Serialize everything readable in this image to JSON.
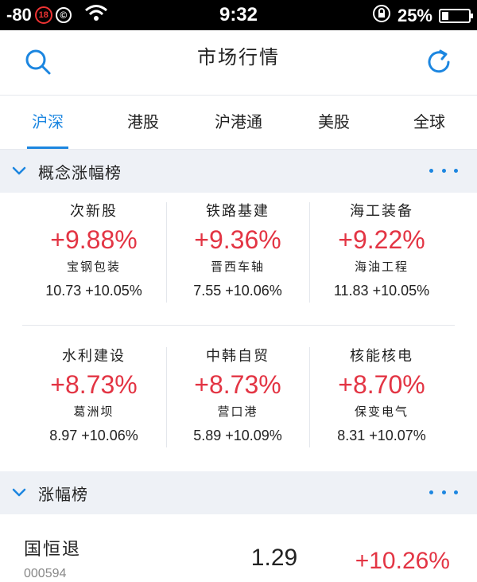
{
  "status_bar": {
    "signal": "-80",
    "badge": "18",
    "copyright": "©",
    "time": "9:32",
    "battery": "25%",
    "battery_level": 0.25
  },
  "header": {
    "title": "市场行情"
  },
  "tabs": [
    {
      "label": "沪深",
      "active": true
    },
    {
      "label": "港股",
      "active": false
    },
    {
      "label": "沪港通",
      "active": false
    },
    {
      "label": "美股",
      "active": false
    },
    {
      "label": "全球",
      "active": false
    }
  ],
  "colors": {
    "accent": "#1c86e0",
    "up": "#e33544",
    "section_bg": "#eef1f6"
  },
  "concept_section": {
    "title": "概念涨幅榜",
    "items": [
      {
        "name": "次新股",
        "change": "+9.88%",
        "stock": "宝钢包装",
        "price": "10.73",
        "stock_change": "+10.05%"
      },
      {
        "name": "铁路基建",
        "change": "+9.36%",
        "stock": "晋西车轴",
        "price": "7.55",
        "stock_change": "+10.06%"
      },
      {
        "name": "海工装备",
        "change": "+9.22%",
        "stock": "海油工程",
        "price": "11.83",
        "stock_change": "+10.05%"
      },
      {
        "name": "水利建设",
        "change": "+8.73%",
        "stock": "葛洲坝",
        "price": "8.97",
        "stock_change": "+10.06%"
      },
      {
        "name": "中韩自贸",
        "change": "+8.73%",
        "stock": "营口港",
        "price": "5.89",
        "stock_change": "+10.09%"
      },
      {
        "name": "核能核电",
        "change": "+8.70%",
        "stock": "保变电气",
        "price": "8.31",
        "stock_change": "+10.07%"
      }
    ]
  },
  "gainers_section": {
    "title": "涨幅榜",
    "rows": [
      {
        "name": "国恒退",
        "code": "000594",
        "price": "1.29",
        "change": "+10.26%"
      }
    ]
  }
}
